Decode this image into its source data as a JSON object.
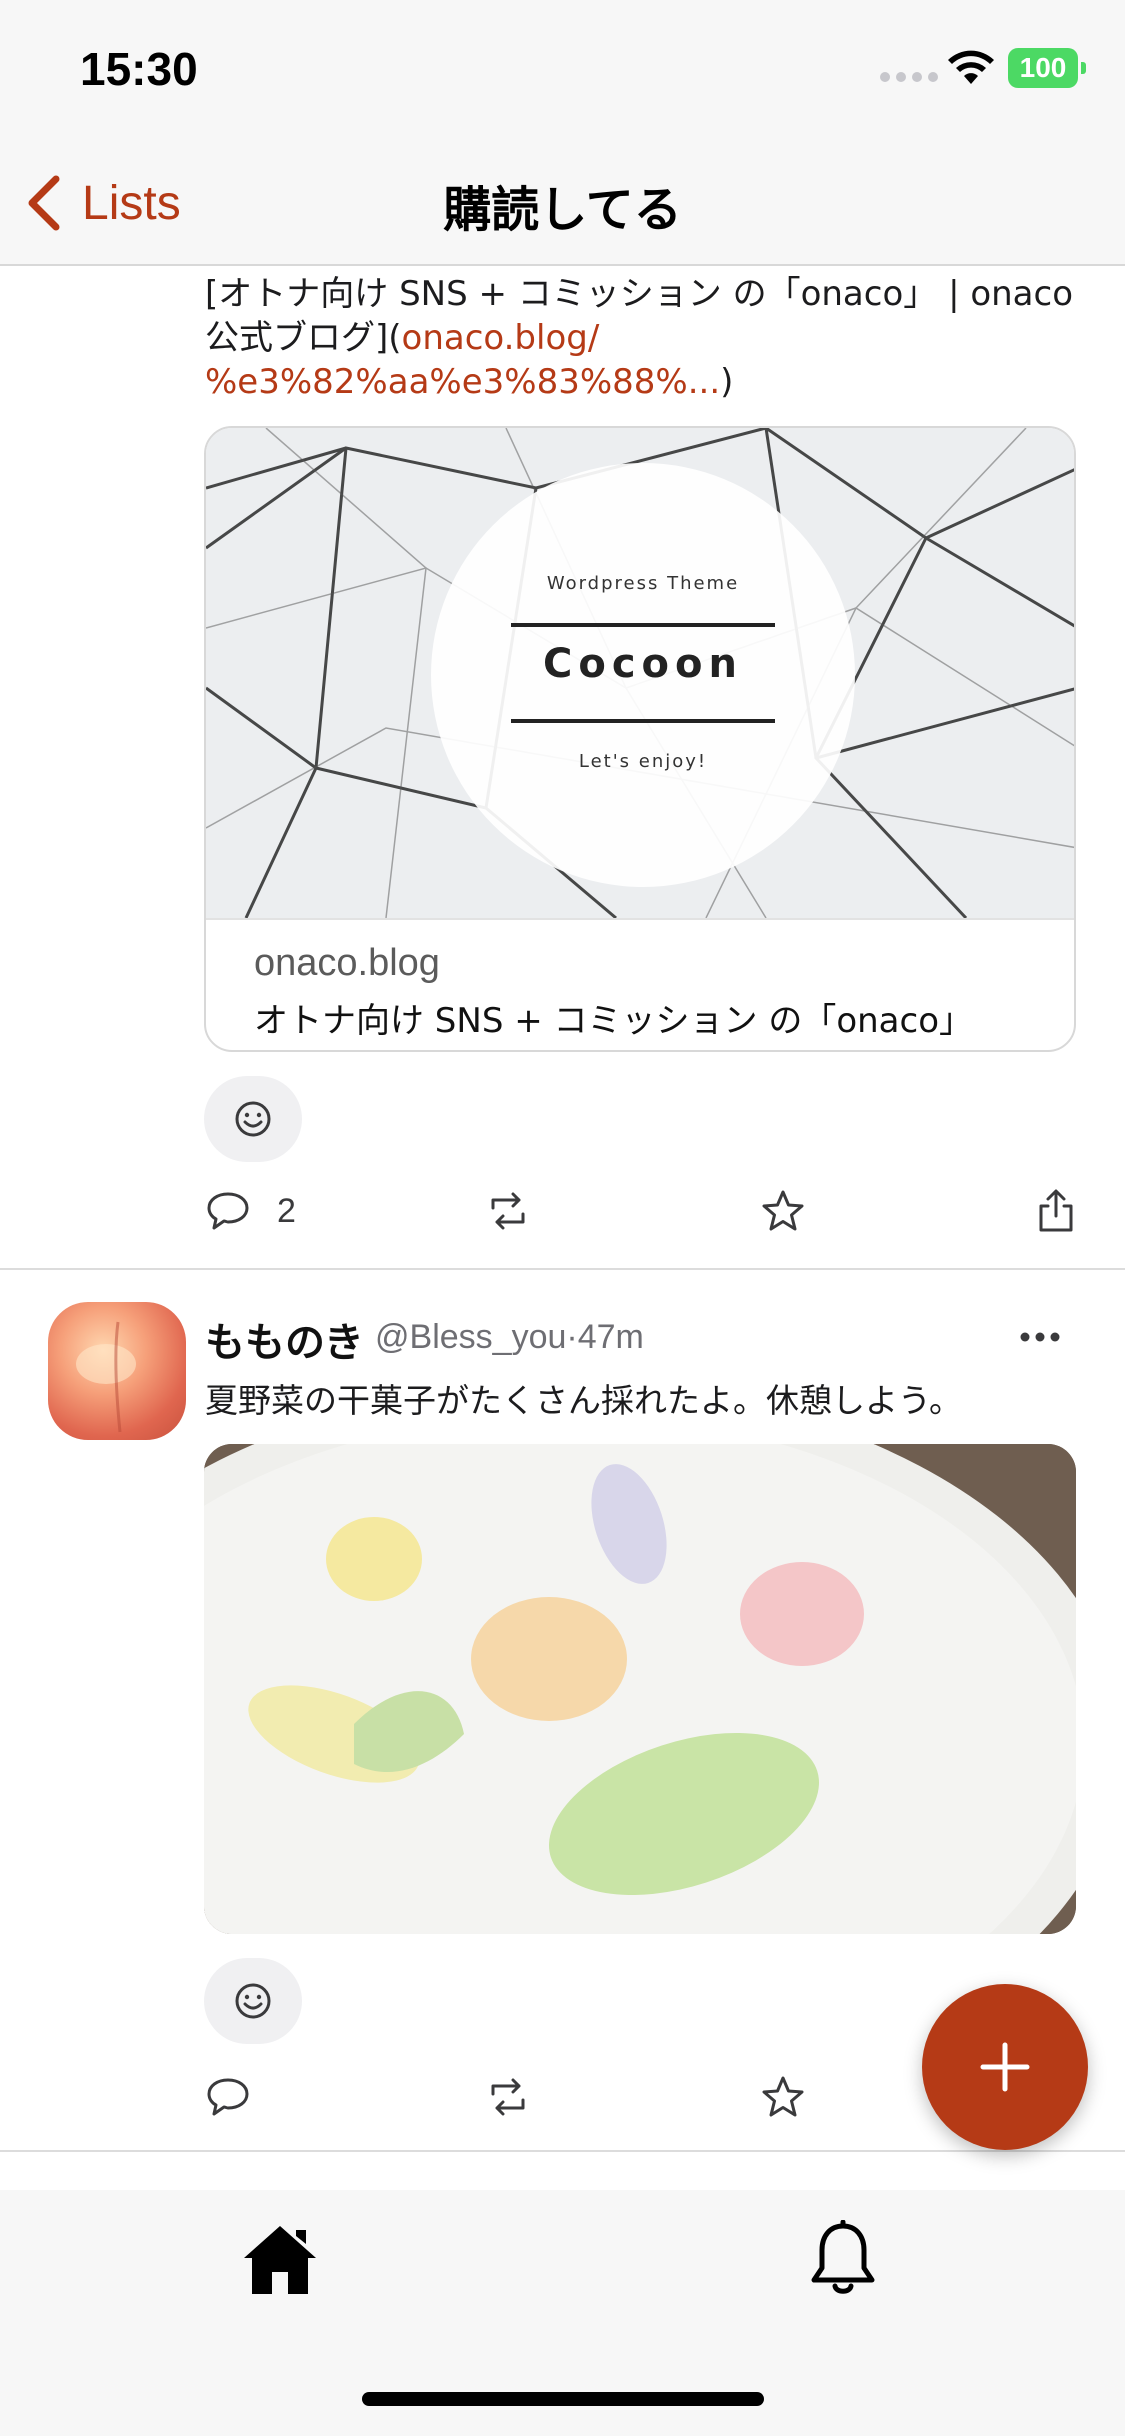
{
  "status_bar": {
    "time": "15:30",
    "battery": "100"
  },
  "nav": {
    "back_label": "Lists",
    "title": "購読してる"
  },
  "post1": {
    "text_line1": "[オトナ向け SNS + コミッション の「onaco」 | onaco",
    "text_line2_prefix": "公式ブログ](",
    "link_part1": "onaco.blog/",
    "link_part2": "%e3%82%aa%e3%83%88%...",
    "text_suffix": ")",
    "card": {
      "theme_label": "Wordpress Theme",
      "brand": "Cocoon",
      "tagline": "Let's enjoy!",
      "domain": "onaco.blog",
      "title": "オトナ向け SNS + コミッション の「onaco」"
    },
    "reply_count": "2"
  },
  "post2": {
    "name": "もものき",
    "handle": "@Bless_you·47m",
    "text": "夏野菜の干菓子がたくさん採れたよ。休憩しよう。"
  },
  "colors": {
    "accent": "#b53a16",
    "divider": "#dcdcdc",
    "battery": "#4cd964"
  },
  "icons": [
    "chevron-left-icon",
    "wifi-icon",
    "smiley-icon",
    "reply-icon",
    "repost-icon",
    "star-icon",
    "share-icon",
    "more-icon",
    "plus-icon",
    "home-icon",
    "bell-icon"
  ]
}
